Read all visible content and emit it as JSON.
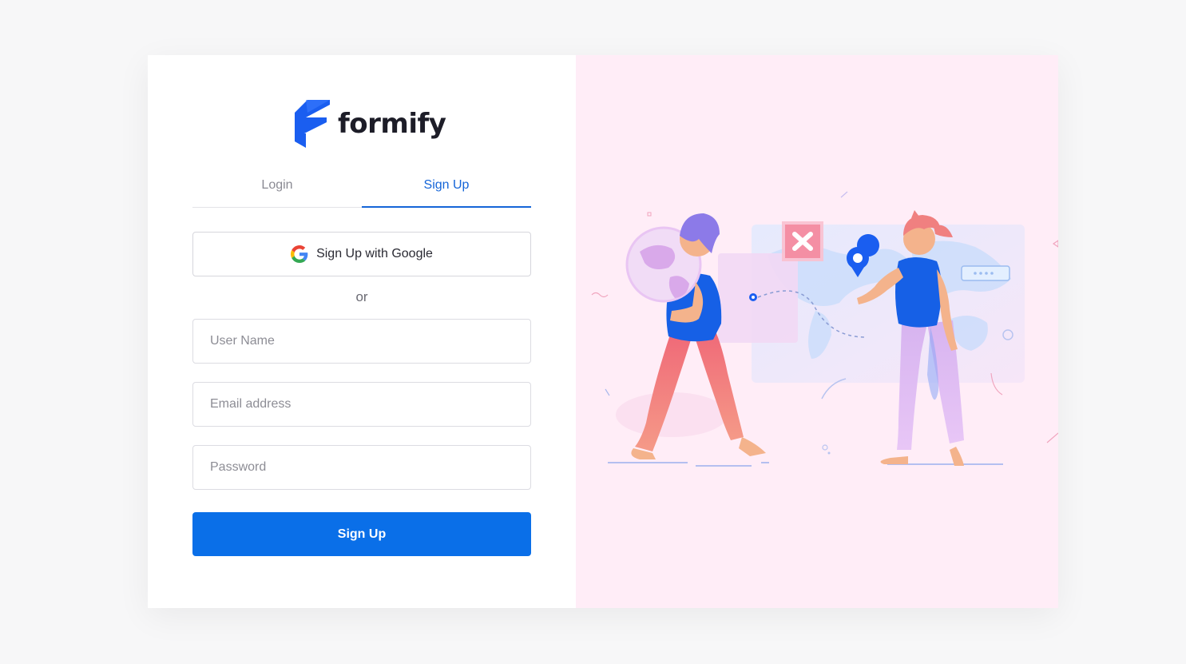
{
  "brand": {
    "name": "formify",
    "colors": {
      "primary": "#0a6fe8",
      "mark": "#1a5ef0",
      "panel": "#ffedf7"
    }
  },
  "tabs": [
    {
      "label": "Login",
      "active": false
    },
    {
      "label": "Sign Up",
      "active": true
    }
  ],
  "google_button": {
    "label": "Sign Up with Google",
    "icon": "google-icon"
  },
  "divider_text": "or",
  "fields": {
    "username": {
      "placeholder": "User Name",
      "value": ""
    },
    "email": {
      "placeholder": "Email address",
      "value": ""
    },
    "password": {
      "placeholder": "Password",
      "value": ""
    }
  },
  "submit": {
    "label": "Sign Up"
  }
}
